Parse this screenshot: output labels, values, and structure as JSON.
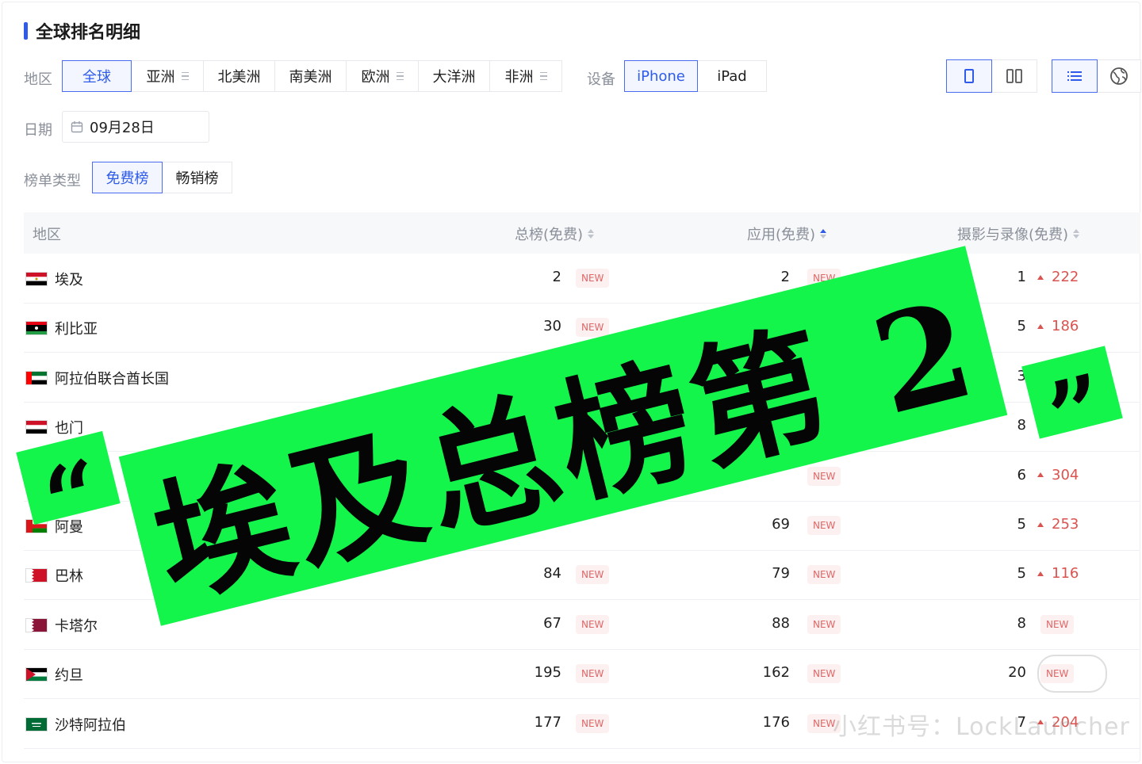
{
  "title": "全球排名明细",
  "filters": {
    "region_label": "地区",
    "regions": [
      {
        "label": "全球",
        "active": true,
        "menu": false
      },
      {
        "label": "亚洲",
        "active": false,
        "menu": true
      },
      {
        "label": "北美洲",
        "active": false,
        "menu": false
      },
      {
        "label": "南美洲",
        "active": false,
        "menu": false
      },
      {
        "label": "欧洲",
        "active": false,
        "menu": true
      },
      {
        "label": "大洋洲",
        "active": false,
        "menu": false
      },
      {
        "label": "非洲",
        "active": false,
        "menu": true
      }
    ],
    "device_label": "设备",
    "devices": [
      {
        "label": "iPhone",
        "active": true
      },
      {
        "label": "iPad",
        "active": false
      }
    ],
    "date_label": "日期",
    "date_value": "09月28日",
    "chart_type_label": "榜单类型",
    "chart_types": [
      {
        "label": "免费榜",
        "active": true
      },
      {
        "label": "畅销榜",
        "active": false
      }
    ]
  },
  "table": {
    "headers": {
      "region": "地区",
      "overall": "总榜(免费)",
      "apps": "应用(免费)",
      "photo": "摄影与录像(免费)"
    },
    "new_label": "NEW",
    "rows": [
      {
        "country": "埃及",
        "flag": "eg",
        "overall": "2",
        "overall_change": "NEW",
        "apps": "2",
        "apps_change": "NEW",
        "photo": "1",
        "photo_change": "222",
        "photo_up": true
      },
      {
        "country": "利比亚",
        "flag": "ly",
        "overall": "30",
        "overall_change": "NEW",
        "apps": "",
        "apps_change": "",
        "photo": "5",
        "photo_change": "186",
        "photo_up": true
      },
      {
        "country": "阿拉伯联合酋长国",
        "flag": "ae",
        "overall": "",
        "overall_change": "",
        "apps": "",
        "apps_change": "",
        "photo": "3",
        "photo_change": "",
        "photo_up": false
      },
      {
        "country": "也门",
        "flag": "ye",
        "overall": "",
        "overall_change": "",
        "apps": "",
        "apps_change": "",
        "photo": "8",
        "photo_change": "",
        "photo_up": false
      },
      {
        "country": "",
        "flag": "",
        "overall": "",
        "overall_change": "",
        "apps": "",
        "apps_change": "NEW",
        "photo": "6",
        "photo_change": "304",
        "photo_up": true
      },
      {
        "country": "阿曼",
        "flag": "om",
        "overall": "",
        "overall_change": "",
        "apps": "69",
        "apps_change": "NEW",
        "photo": "5",
        "photo_change": "253",
        "photo_up": true
      },
      {
        "country": "巴林",
        "flag": "bh",
        "overall": "84",
        "overall_change": "NEW",
        "apps": "79",
        "apps_change": "NEW",
        "photo": "5",
        "photo_change": "116",
        "photo_up": true
      },
      {
        "country": "卡塔尔",
        "flag": "qa",
        "overall": "67",
        "overall_change": "NEW",
        "apps": "88",
        "apps_change": "NEW",
        "photo": "8",
        "photo_change": "NEW",
        "photo_up": false
      },
      {
        "country": "约旦",
        "flag": "jo",
        "overall": "195",
        "overall_change": "NEW",
        "apps": "162",
        "apps_change": "NEW",
        "photo": "20",
        "photo_change": "NEW",
        "photo_up": false
      },
      {
        "country": "沙特阿拉伯",
        "flag": "sa",
        "overall": "177",
        "overall_change": "NEW",
        "apps": "176",
        "apps_change": "NEW",
        "photo": "7",
        "photo_change": "204",
        "photo_up": true
      }
    ]
  },
  "overlay": {
    "banner_text": "埃及总榜第 2",
    "open_quote": "“",
    "close_quote": "”",
    "color": "#14f54b"
  },
  "watermark": "小红书号：LockLauncher",
  "colors": {
    "accent": "#2f5bea",
    "new_badge_bg": "#fdf0f0",
    "trend_up": "#d9534f"
  }
}
